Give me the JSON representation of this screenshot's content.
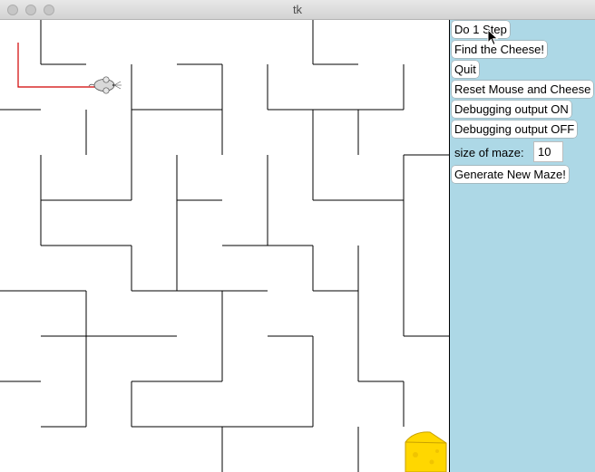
{
  "window": {
    "title": "tk"
  },
  "controls": {
    "step_label": "Do 1 Step",
    "find_label": "Find the Cheese!",
    "quit_label": "Quit",
    "reset_label": "Reset Mouse and Cheese",
    "debug_on_label": "Debugging output ON",
    "debug_off_label": "Debugging output OFF",
    "size_label": "size of maze:",
    "size_value": "10",
    "generate_label": "Generate New Maze!"
  },
  "maze": {
    "size": 10,
    "mouse_icon": "mouse-icon",
    "cheese_icon": "cheese-icon",
    "path_color": "#d00000"
  },
  "colors": {
    "panel_bg": "#add8e6",
    "maze_bg": "#ffffff",
    "wall": "#000000",
    "cheese": "#ffd700"
  }
}
